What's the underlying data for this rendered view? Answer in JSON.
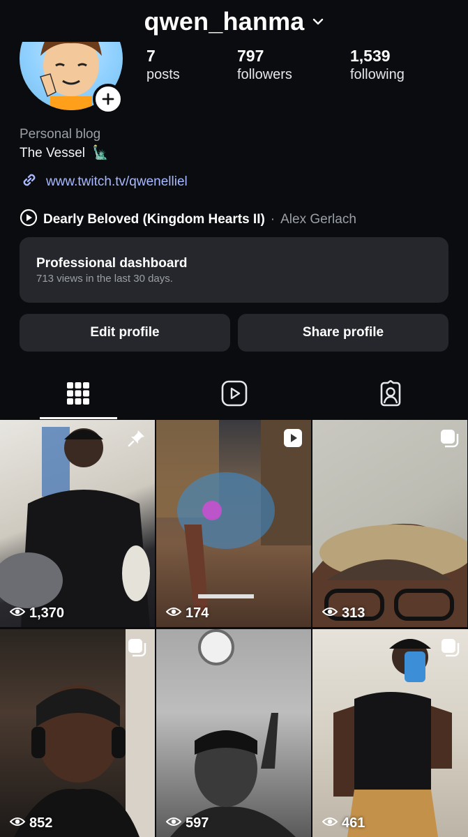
{
  "header": {
    "username": "qwen_hanma"
  },
  "stats": [
    {
      "value": "7",
      "label": "posts"
    },
    {
      "value": "797",
      "label": "followers"
    },
    {
      "value": "1,539",
      "label": "following"
    }
  ],
  "bio": {
    "category": "Personal blog",
    "text": "The Vessel",
    "emoji": "🗽",
    "link": "www.twitch.tv/qwenelliel",
    "music_title": "Dearly Beloved (Kingdom Hearts II)",
    "music_dot": "·",
    "music_artist": "Alex Gerlach"
  },
  "dashboard": {
    "title": "Professional dashboard",
    "subtitle": "713 views in the last 30 days."
  },
  "buttons": {
    "edit": "Edit profile",
    "share": "Share profile"
  },
  "posts": [
    {
      "views": "1,370",
      "badge": "pin"
    },
    {
      "views": "174",
      "badge": "video"
    },
    {
      "views": "313",
      "badge": "carousel"
    },
    {
      "views": "852",
      "badge": "carousel"
    },
    {
      "views": "597",
      "badge": "none"
    },
    {
      "views": "461",
      "badge": "carousel"
    }
  ]
}
